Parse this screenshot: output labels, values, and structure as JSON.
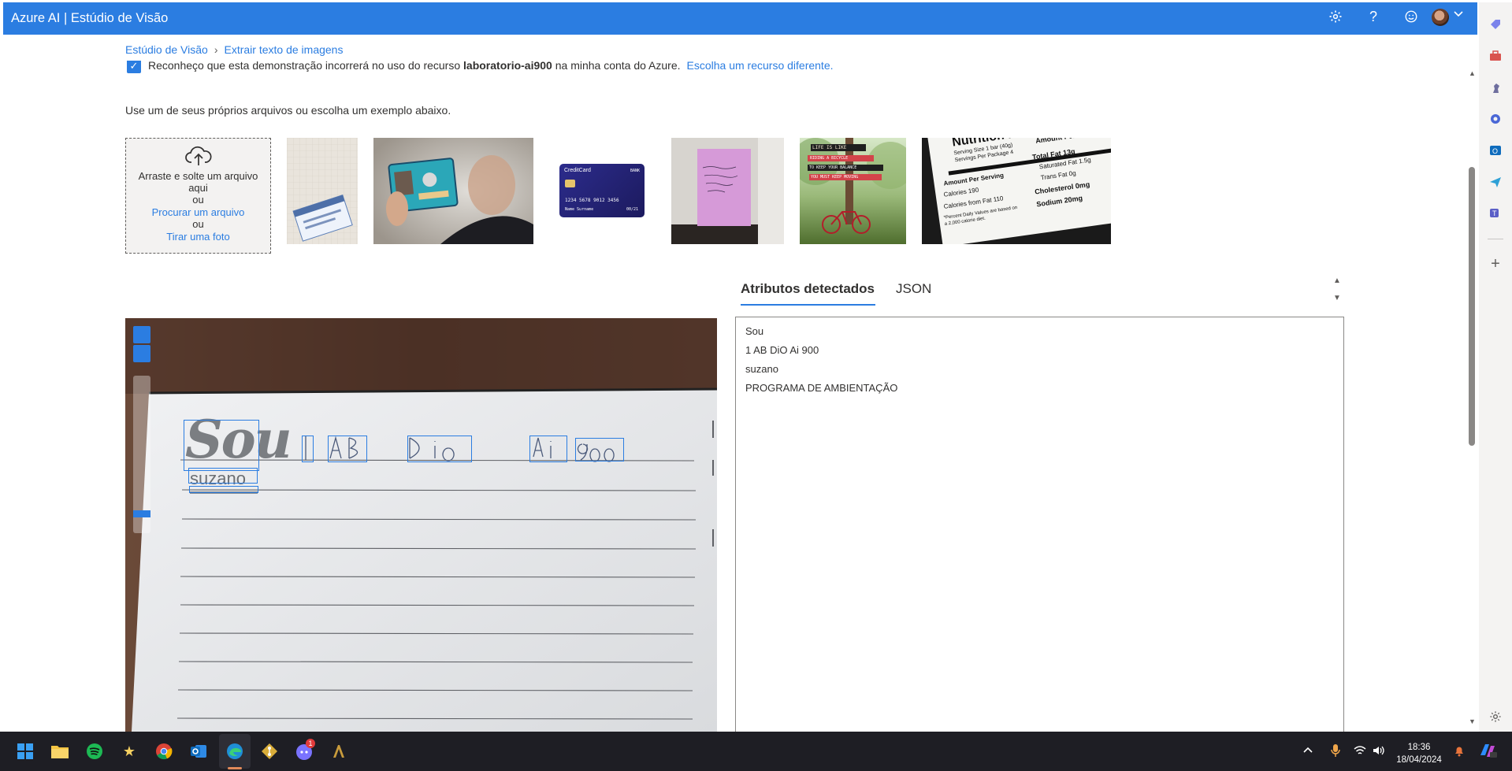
{
  "app": {
    "title": "Azure AI | Estúdio de Visão"
  },
  "topbar_icons": [
    "gear-icon",
    "help-icon",
    "feedback-smiley-icon",
    "avatar",
    "chevron-down-icon"
  ],
  "breadcrumb": {
    "root": "Estúdio de Visão",
    "separator": "›",
    "current": "Extrair texto de imagens"
  },
  "consent": {
    "text_before": "Reconheço que esta demonstração incorrerá no uso do recurso ",
    "resource": "laboratorio-ai900",
    "text_after": " na minha conta do Azure.",
    "link": "Escolha um recurso diferente."
  },
  "instructions": "Use um de seus próprios arquivos ou escolha um exemplo abaixo.",
  "dropzone": {
    "drag_text": "Arraste e solte um arquivo aqui",
    "or1": "ou",
    "browse_link": "Procurar um arquivo",
    "or2": "ou",
    "photo_link": "Tirar uma foto"
  },
  "sample_thumbnails": [
    {
      "name": "social-security-card"
    },
    {
      "name": "id-badge-person"
    },
    {
      "name": "credit-card",
      "brand_text": "CreditCard",
      "bank_text": "BANK",
      "number_text": "1234 5678 9012 3456",
      "holder_text": "Name Surname",
      "expiry_text": "00/21"
    },
    {
      "name": "sticky-note"
    },
    {
      "name": "bicycle-poster",
      "lines": [
        "LIFE IS LIKE",
        "RIDING A BICYCLE",
        "TO KEEP YOUR BALANCE",
        "YOU MUST KEEP MOVING"
      ]
    },
    {
      "name": "nutrition-facts",
      "title": "Nutrition Facts",
      "subtitle1": "Serving Size 1 bar (40g)",
      "subtitle2": "Servings Per Package 4",
      "col": "Amount Per Serving",
      "rows": [
        "Total Fat 13g",
        "Saturated Fat 1.5g",
        "Trans Fat 0g",
        "Cholesterol 0mg",
        "Sodium 20mg"
      ],
      "left_rows": [
        "Amount Per Serving",
        "Calories 190",
        "Calories from Fat 110",
        "*Percent Daily Values are based on",
        "a 2,000 calorie diet."
      ]
    }
  ],
  "tabs": {
    "attributes": "Atributos detectados",
    "json": "JSON"
  },
  "detected_lines": [
    "Sou",
    "1 AB DiO Ai 900",
    "suzano",
    "PROGRAMA DE AMBIENTAÇÃO"
  ],
  "notebook_overlay": {
    "logo_word": "Sou",
    "brand": "suzano",
    "handwriting": [
      "1",
      "AB",
      "DiO",
      "Ai",
      "900"
    ]
  },
  "taskbar": {
    "apps": [
      "windows-start-icon",
      "file-explorer-icon",
      "spotify-icon",
      "app-star-icon",
      "chrome-icon",
      "outlook-icon",
      "edge-icon",
      "git-icon",
      "discord-icon",
      "dota-icon"
    ],
    "discord_badge": "1",
    "time": "18:36",
    "date": "18/04/2024"
  },
  "colors": {
    "accent": "#2b7de1",
    "taskbar": "#1e1e24"
  }
}
